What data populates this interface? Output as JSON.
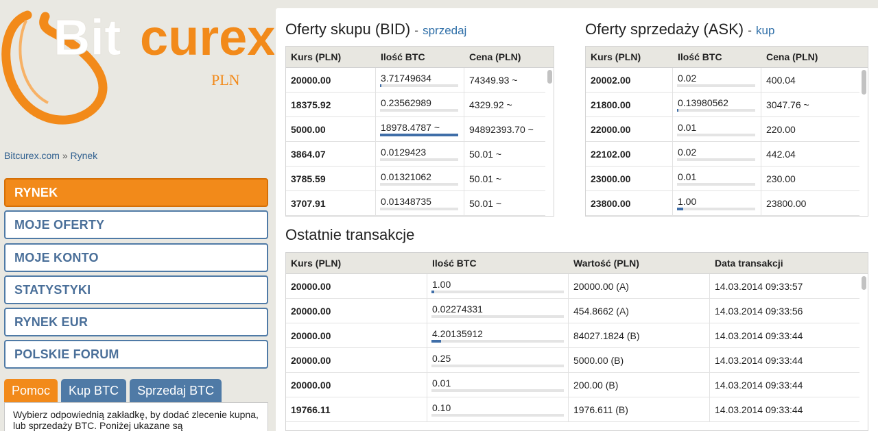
{
  "logo": {
    "brand": "Bitcurex",
    "sub": "PLN"
  },
  "breadcrumb": {
    "home": "Bitcurex.com",
    "sep": "»",
    "current": "Rynek"
  },
  "nav": {
    "items": [
      {
        "label": "RYNEK",
        "active": true
      },
      {
        "label": "MOJE OFERTY"
      },
      {
        "label": "MOJE KONTO"
      },
      {
        "label": "STATYSTYKI"
      },
      {
        "label": "RYNEK EUR"
      },
      {
        "label": "POLSKIE FORUM"
      }
    ]
  },
  "tabs": [
    {
      "label": "Pomoc",
      "active": true
    },
    {
      "label": "Kup BTC"
    },
    {
      "label": "Sprzedaj BTC"
    }
  ],
  "help_text": "Wybierz odpowiednią zakładkę, by dodać zlecenie kupna, lub sprzedaży BTC. Poniżej ukazane są",
  "bid": {
    "title": "Oferty skupu (BID)",
    "dash": "-",
    "link": "sprzedaj",
    "headers": [
      "Kurs (PLN)",
      "Ilość BTC",
      "Cena (PLN)"
    ],
    "rows": [
      {
        "rate": "20000.00",
        "qty": "3.71749634",
        "price": "74349.93 ~",
        "level": 0.02
      },
      {
        "rate": "18375.92",
        "qty": "0.23562989",
        "price": "4329.92 ~",
        "level": 0.0
      },
      {
        "rate": "5000.00",
        "qty": "18978.4787 ~",
        "price": "94892393.70 ~",
        "level": 1.0
      },
      {
        "rate": "3864.07",
        "qty": "0.0129423",
        "price": "50.01 ~",
        "level": 0.0
      },
      {
        "rate": "3785.59",
        "qty": "0.01321062",
        "price": "50.01 ~",
        "level": 0.0
      },
      {
        "rate": "3707.91",
        "qty": "0.01348735",
        "price": "50.01 ~",
        "level": 0.0
      }
    ]
  },
  "ask": {
    "title": "Oferty sprzedaży (ASK)",
    "dash": "-",
    "link": "kup",
    "headers": [
      "Kurs (PLN)",
      "Ilość BTC",
      "Cena (PLN)"
    ],
    "rows": [
      {
        "rate": "20002.00",
        "qty": "0.02",
        "price": "400.04",
        "level": 0.0
      },
      {
        "rate": "21800.00",
        "qty": "0.13980562",
        "price": "3047.76 ~",
        "level": 0.01
      },
      {
        "rate": "22000.00",
        "qty": "0.01",
        "price": "220.00",
        "level": 0.0
      },
      {
        "rate": "22102.00",
        "qty": "0.02",
        "price": "442.04",
        "level": 0.0
      },
      {
        "rate": "23000.00",
        "qty": "0.01",
        "price": "230.00",
        "level": 0.0
      },
      {
        "rate": "23800.00",
        "qty": "1.00",
        "price": "23800.00",
        "level": 0.08
      }
    ]
  },
  "trades": {
    "title": "Ostatnie transakcje",
    "headers": [
      "Kurs (PLN)",
      "Ilość BTC",
      "Wartość (PLN)",
      "Data transakcji"
    ],
    "rows": [
      {
        "rate": "20000.00",
        "qty": "1.00",
        "value": "20000.00 (A)",
        "date": "14.03.2014 09:33:57",
        "level": 0.02
      },
      {
        "rate": "20000.00",
        "qty": "0.02274331",
        "value": "454.8662 (A)",
        "date": "14.03.2014 09:33:56",
        "level": 0.0
      },
      {
        "rate": "20000.00",
        "qty": "4.20135912",
        "value": "84027.1824 (B)",
        "date": "14.03.2014 09:33:44",
        "level": 0.07
      },
      {
        "rate": "20000.00",
        "qty": "0.25",
        "value": "5000.00 (B)",
        "date": "14.03.2014 09:33:44",
        "level": 0.0
      },
      {
        "rate": "20000.00",
        "qty": "0.01",
        "value": "200.00 (B)",
        "date": "14.03.2014 09:33:44",
        "level": 0.0
      },
      {
        "rate": "19766.11",
        "qty": "0.10",
        "value": "1976.611 (B)",
        "date": "14.03.2014 09:33:44",
        "level": 0.0
      }
    ]
  },
  "colors": {
    "accent": "#f28a1a",
    "nav": "#4f7aa6",
    "bar": "#3f6ea8",
    "link": "#2f6fa8"
  }
}
